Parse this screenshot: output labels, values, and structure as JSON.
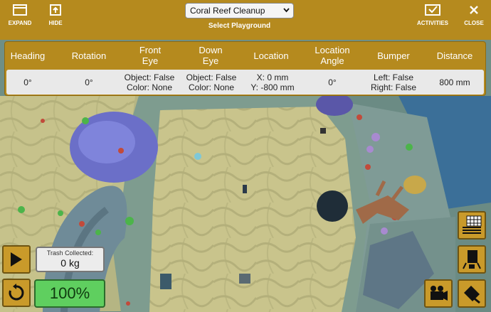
{
  "topbar": {
    "expand_label": "EXPAND",
    "hide_label": "HIDE",
    "playground_value": "Coral Reef Cleanup",
    "playground_caption": "Select Playground",
    "activities_label": "ACTIVITIES",
    "close_label": "CLOSE"
  },
  "sensors": {
    "headers": {
      "heading": "Heading",
      "rotation": "Rotation",
      "front_eye_1": "Front",
      "front_eye_2": "Eye",
      "down_eye_1": "Down",
      "down_eye_2": "Eye",
      "location": "Location",
      "location_angle_1": "Location",
      "location_angle_2": "Angle",
      "bumper": "Bumper",
      "distance": "Distance"
    },
    "values": {
      "heading": "0°",
      "rotation": "0°",
      "front_eye_object": "Object: False",
      "front_eye_color": "Color: None",
      "down_eye_object": "Object: False",
      "down_eye_color": "Color: None",
      "location_x": "X: 0 mm",
      "location_y": "Y: -800 mm",
      "location_angle": "0°",
      "bumper_left": "Left: False",
      "bumper_right": "Right: False",
      "distance": "800 mm"
    }
  },
  "hud": {
    "trash_label": "Trash Collected:",
    "trash_value": "0 kg",
    "speed": "100%"
  },
  "colors": {
    "accent": "#b58a1e",
    "speed_green": "#5fcf5f",
    "panel_grey": "#e9e9e9"
  },
  "icons": [
    "expand-icon",
    "hide-icon",
    "activities-icon",
    "close-icon",
    "play-icon",
    "reset-icon",
    "dashboard-icon",
    "top-view-camera-icon",
    "follow-camera-icon",
    "side-camera-icon"
  ]
}
